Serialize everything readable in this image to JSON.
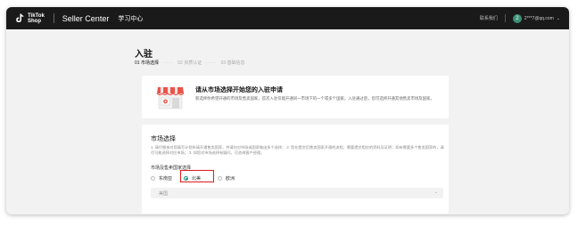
{
  "header": {
    "logo_line1": "TikTok",
    "logo_line2": "Shop",
    "brand": "Seller Center",
    "learn_center": "学习中心",
    "contact": "联系我们",
    "avatar_initial": "2",
    "email": "2***7@qq.com"
  },
  "page": {
    "title": "入驻",
    "steps": [
      {
        "label": "01 市场选择",
        "state": "active"
      },
      {
        "label": "02 资质认证",
        "state": "inactive"
      },
      {
        "label": "03 基础信息",
        "state": "inactive"
      }
    ],
    "step_separator": "·····"
  },
  "intro_card": {
    "title": "请从市场选择开始您的入驻申请",
    "desc": "新选择你希望开通的市场及售卖国家，首次入驻仅能开通同一市场下的一个或多个国家，入驻通过后，您可选择开通其他售卖市场及国家。"
  },
  "market_card": {
    "title": "市场选择",
    "desc": "1. 请仔细核对您填写计划申请开通售卖国家，并请勿对市场或国家做出多个选择；  2. 您在提交后售卖国家开通的流程，需要提交相应的资料及证明；如有需要多个售卖国家的，请尽可能选择对应市场；  3. 如您对市场选择有疑问，可咨询客户经理。",
    "field_label": "市场及售卖国家选择",
    "options": [
      {
        "label": "东南亚",
        "checked": false
      },
      {
        "label": "北美",
        "checked": true
      },
      {
        "label": "欧洲",
        "checked": false
      }
    ],
    "select_value": "美国"
  },
  "colors": {
    "accent": "#1a8c7c",
    "highlight": "#e01b1b",
    "topbar": "#1a1a1a"
  }
}
